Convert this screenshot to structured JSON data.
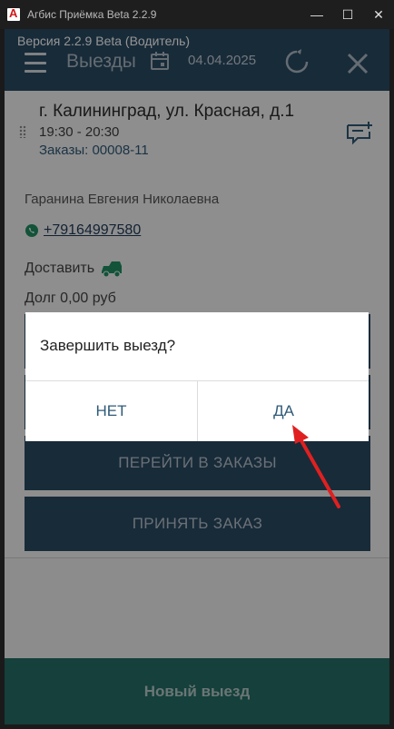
{
  "window": {
    "title": "Агбис Приёмка Beta 2.2.9",
    "controls": {
      "minimize": "—",
      "maximize": "☐",
      "close": "✕"
    }
  },
  "header": {
    "version": "Версия 2.2.9 Beta (Водитель)",
    "section_title": "Выезды",
    "date": "04.04.2025",
    "icons": [
      "menu-icon",
      "calendar-icon",
      "refresh-icon",
      "close-icon"
    ]
  },
  "trip": {
    "address": "г. Калининград, ул. Красная, д.1",
    "time": "19:30 - 20:30",
    "orders": "Заказы: 00008-11",
    "person": "Гаранина Евгения Николаевна",
    "phone": "+79164997580",
    "action": "Доставить",
    "debt": "Долг 0,00 руб",
    "buttons": {
      "go_to_orders": "ПЕРЕЙТИ В ЗАКАЗЫ",
      "accept_order": "ПРИНЯТЬ ЗАКАЗ"
    }
  },
  "dialog": {
    "message": "Завершить выезд?",
    "no": "НЕТ",
    "yes": "ДА"
  },
  "footer": {
    "new_trip": "Новый выезд"
  },
  "colors": {
    "header_bg": "#2a4a63",
    "footer_bg": "#256f67",
    "accent_text": "#2f5a78",
    "annotation_arrow": "#e02020"
  }
}
